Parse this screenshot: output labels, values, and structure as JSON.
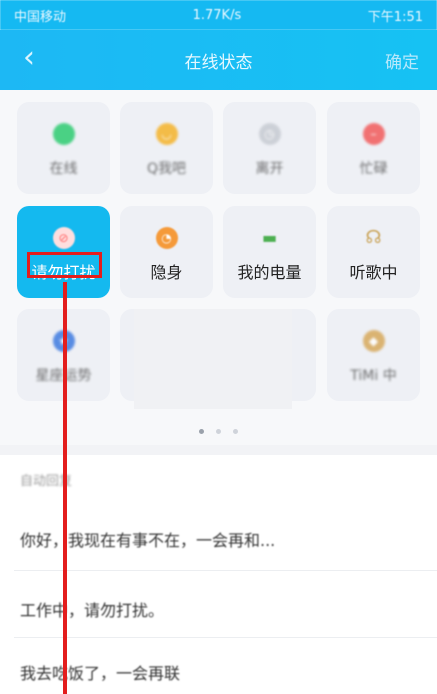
{
  "status_bar": {
    "carrier": "中国移动",
    "speed": "1.77K/s",
    "time": "下午1:51"
  },
  "nav": {
    "title": "在线状态",
    "confirm": "确定",
    "back_icon": "chevron-left-icon"
  },
  "tiles": [
    {
      "label": "在线",
      "icon": "online-dot-icon",
      "color": "#2ecc71"
    },
    {
      "label": "Q我吧",
      "icon": "smile-icon",
      "color": "#f5b32a"
    },
    {
      "label": "离开",
      "icon": "clock-icon",
      "color": "#c7cbd2"
    },
    {
      "label": "忙碌",
      "icon": "minus-circle-icon",
      "color": "#f25c5c"
    },
    {
      "label": "请勿打扰",
      "icon": "no-disturb-icon",
      "color": "#ff7a7a"
    },
    {
      "label": "隐身",
      "icon": "invisible-icon",
      "color": "#f59a3a"
    },
    {
      "label": "我的电量",
      "icon": "battery-icon",
      "color": "#4caf50"
    },
    {
      "label": "听歌中",
      "icon": "headphones-icon",
      "color": "#c9a256"
    },
    {
      "label": "星座运势",
      "icon": "constellation-icon",
      "color": "#3f7be0"
    },
    {
      "label": "TiMi 中",
      "icon": "game-icon",
      "color": "#d7a95c"
    }
  ],
  "auto_reply": {
    "title": "自动回复",
    "items": [
      "你好，我现在有事不在，一会再和...",
      "工作中，请勿打扰。",
      "我去吃饭了，一会再联"
    ]
  },
  "colors": {
    "accent": "#14b9ef",
    "highlight": "#e31d1d"
  }
}
